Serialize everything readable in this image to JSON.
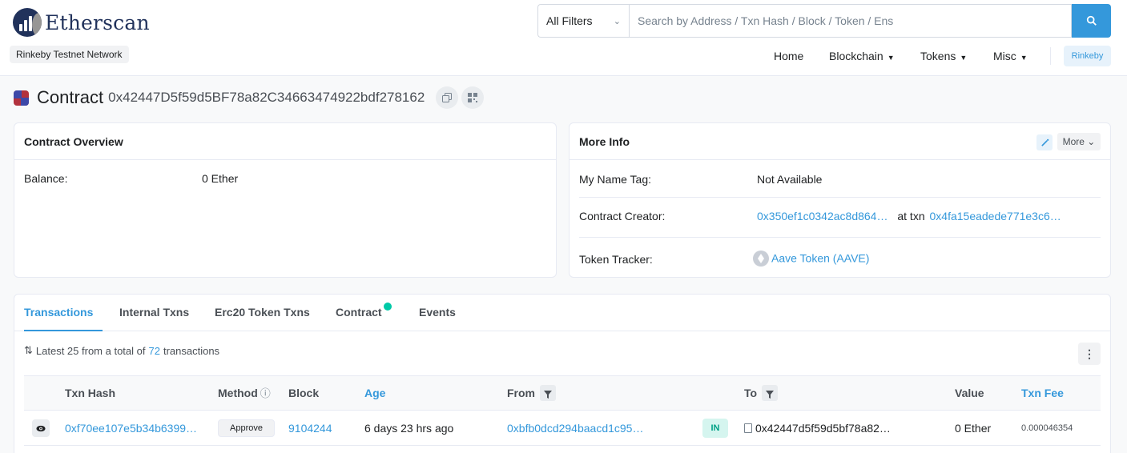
{
  "header": {
    "logo_text": "Etherscan",
    "network_badge": "Rinkeby Testnet Network",
    "search": {
      "filter_label": "All Filters",
      "placeholder": "Search by Address / Txn Hash / Block / Token / Ens"
    },
    "nav": {
      "home": "Home",
      "blockchain": "Blockchain",
      "tokens": "Tokens",
      "misc": "Misc",
      "network": "Rinkeby"
    }
  },
  "page": {
    "title": "Contract",
    "address": "0x42447D5f59d5BF78a82C34663474922bdf278162"
  },
  "overview": {
    "header": "Contract Overview",
    "balance_label": "Balance:",
    "balance_value": "0 Ether"
  },
  "more_info": {
    "header": "More Info",
    "more_label": "More",
    "name_tag_label": "My Name Tag:",
    "name_tag_value": "Not Available",
    "creator_label": "Contract Creator:",
    "creator_address": "0x350ef1c0342ac8d864…",
    "at_txn": "at txn",
    "creator_txn": "0x4fa15eadede771e3c6…",
    "token_tracker_label": "Token Tracker:",
    "token_tracker_value": "Aave Token (AAVE)"
  },
  "tabs": {
    "transactions": "Transactions",
    "internal": "Internal Txns",
    "erc20": "Erc20 Token Txns",
    "contract": "Contract",
    "events": "Events"
  },
  "summary": {
    "prefix": "Latest 25 from a total of",
    "count": "72",
    "suffix": "transactions"
  },
  "table": {
    "columns": {
      "txn_hash": "Txn Hash",
      "method": "Method",
      "block": "Block",
      "age": "Age",
      "from": "From",
      "to": "To",
      "value": "Value",
      "txn_fee": "Txn Fee"
    },
    "rows": [
      {
        "txn_hash": "0xf70ee107e5b34b6399…",
        "method": "Approve",
        "block": "9104244",
        "age": "6 days 23 hrs ago",
        "from": "0xbfb0dcd294baacd1c95…",
        "direction": "IN",
        "to": "0x42447d5f59d5bf78a82…",
        "value": "0 Ether",
        "fee": "0.000046354"
      }
    ]
  },
  "icons": {
    "search": "search-icon",
    "copy": "copy-icon",
    "qr": "qr-code-icon",
    "edit": "edit-icon",
    "eye": "eye-icon",
    "filter": "filter-icon",
    "verified": "verified-check-icon"
  },
  "colors": {
    "accent": "#3498db",
    "brand": "#21325b",
    "success": "#00c9a7"
  }
}
